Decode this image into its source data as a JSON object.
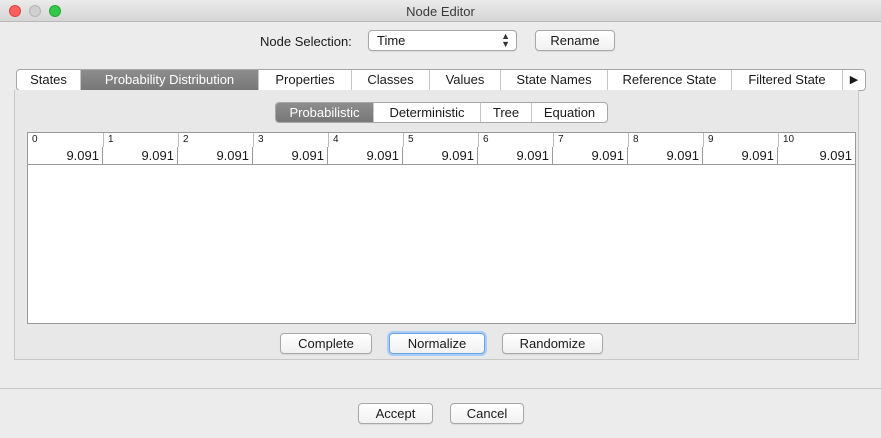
{
  "window": {
    "title": "Node Editor"
  },
  "node_selection": {
    "label": "Node Selection:",
    "value": "Time",
    "rename_label": "Rename"
  },
  "tabs": [
    "States",
    "Probability Distribution",
    "Properties",
    "Classes",
    "Values",
    "State Names",
    "Reference State",
    "Filtered State"
  ],
  "tabs_more": "▶",
  "active_tab": "Probability Distribution",
  "subtabs": [
    "Probabilistic",
    "Deterministic",
    "Tree",
    "Equation"
  ],
  "active_subtab": "Probabilistic",
  "table": {
    "headers": [
      "0",
      "1",
      "2",
      "3",
      "4",
      "5",
      "6",
      "7",
      "8",
      "9",
      "10"
    ],
    "values": [
      "9.091",
      "9.091",
      "9.091",
      "9.091",
      "9.091",
      "9.091",
      "9.091",
      "9.091",
      "9.091",
      "9.091",
      "9.091"
    ]
  },
  "actions": {
    "complete": "Complete",
    "normalize": "Normalize",
    "randomize": "Randomize"
  },
  "dialog": {
    "accept": "Accept",
    "cancel": "Cancel"
  }
}
